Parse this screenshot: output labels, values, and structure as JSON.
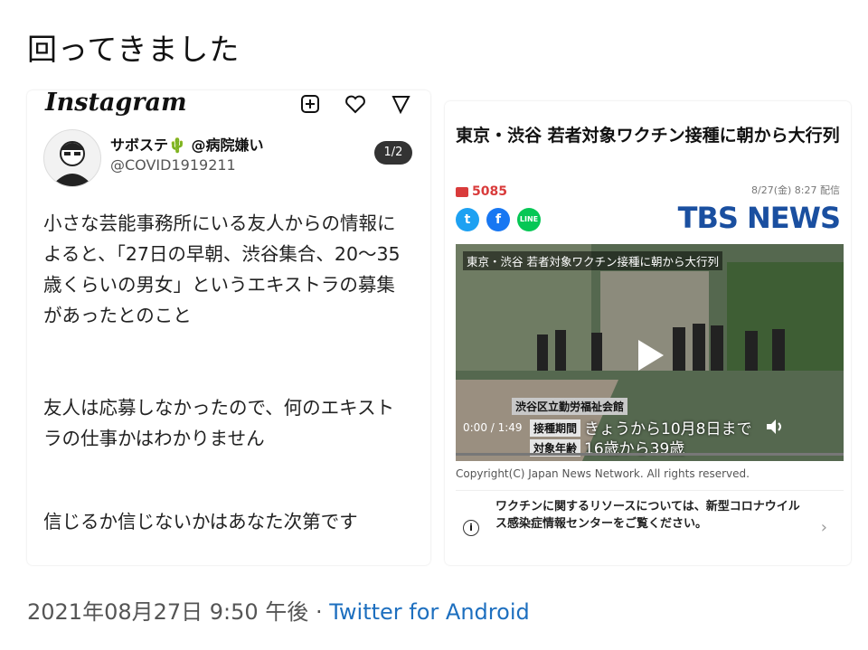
{
  "tweet": {
    "text": "回ってきました",
    "timestamp": "2021年08月27日 9:50 午後",
    "separator": "·",
    "via": "Twitter for Android"
  },
  "left_image": {
    "app": "Instagram",
    "author_name": "サボステ🌵 @病院嫌い",
    "author_handle": "@COVID1919211",
    "page_indicator": "1/2",
    "paragraphs": [
      "小さな芸能事務所にいる友人からの情報によると、「27日の早朝、渋谷集合、20〜35歳くらいの男女」というエキストラの募集があったとのこと",
      "友人は応募しなかったので、何のエキストラの仕事かはわかりません",
      "信じるか信じないかはあなた次第です"
    ]
  },
  "right_image": {
    "headline": "東京・渋谷 若者対象ワクチン接種に朝から大行列",
    "comment_count": "5085",
    "date": "8/27(金) 8:27 配信",
    "brand": "TBS NEWS",
    "video": {
      "caption": "東京・渋谷 若者対象ワクチン接種に朝から大行列",
      "location": "渋谷区立勤労福祉会館",
      "time": "0:00 / 1:49",
      "period_label": "接種期間",
      "period_value": "きょうから10月8日まで",
      "age_label": "対象年齢",
      "age_value": "16歳から39歳"
    },
    "copyright": "Copyright(C) Japan News Network. All rights reserved.",
    "notice": "ワクチンに関するリソースについては、新型コロナウイルス感染症情報センターをご覧ください。",
    "colors": {
      "brand": "#1a4fa0",
      "comment": "#d93b3b"
    }
  }
}
